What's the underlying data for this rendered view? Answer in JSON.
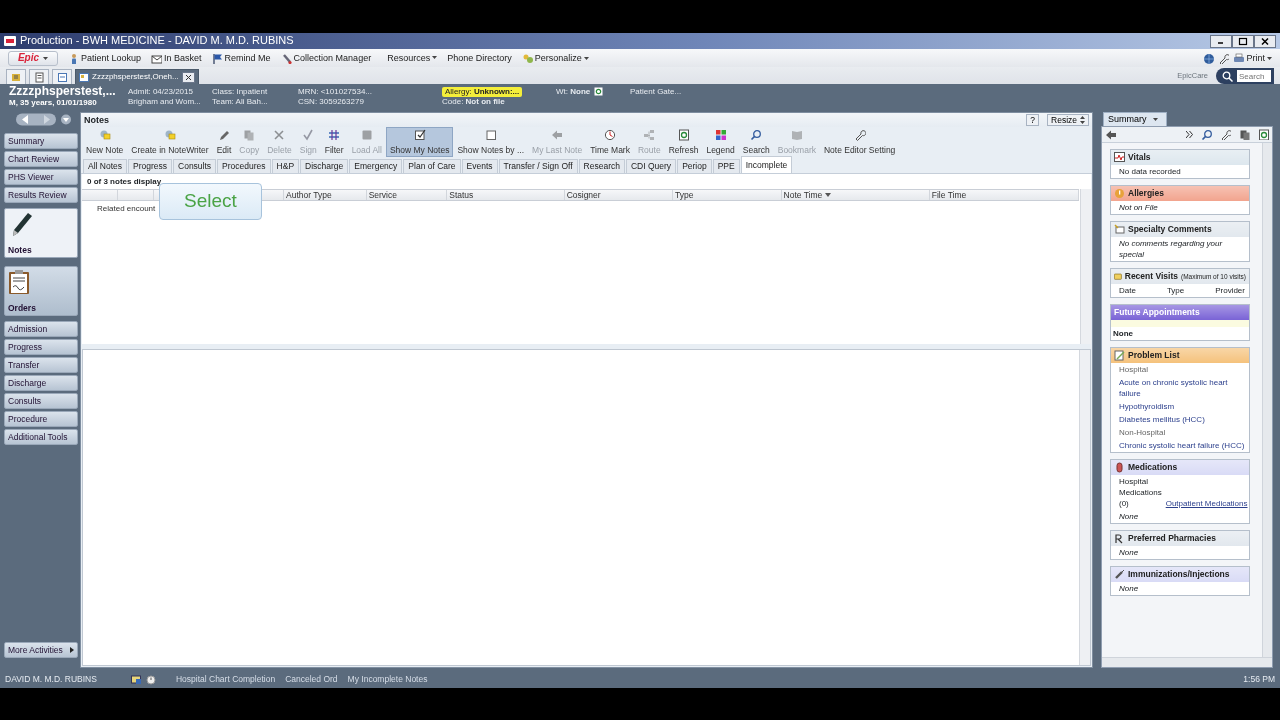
{
  "window": {
    "title": "Production - BWH MEDICINE - DAVID M. M.D. RUBINS"
  },
  "menu": {
    "brand": "Epic",
    "items": [
      {
        "label": "Patient Lookup",
        "dropdown": false
      },
      {
        "label": "In Basket",
        "dropdown": false
      },
      {
        "label": "Remind Me",
        "dropdown": false
      },
      {
        "label": "Collection Manager",
        "dropdown": false
      },
      {
        "label": "Resources",
        "dropdown": true
      },
      {
        "label": "Phone Directory",
        "dropdown": false
      },
      {
        "label": "Personalize",
        "dropdown": true
      }
    ],
    "print": "Print",
    "product": "EpicCare",
    "search_placeholder": "Search"
  },
  "workspace_tabs": [
    {
      "label": "Zzzzphsperstest,Oneh...",
      "selected": true
    }
  ],
  "patient": {
    "name": "Zzzzphsperstest,...",
    "demographics": "M, 35 years, 01/01/1980",
    "columns": [
      [
        {
          "text": "Admit: 04/23/2015",
          "alert": false
        },
        {
          "text": "Brigham and Wom...",
          "alert": false
        }
      ],
      [
        {
          "text": "Class: Inpatient",
          "alert": false
        },
        {
          "text": "Team: Ali Bah...",
          "alert": false
        }
      ],
      [
        {
          "text": "MRN: <101027534...",
          "alert": false
        },
        {
          "text": "CSN: 3059263279",
          "alert": false
        }
      ],
      [
        {
          "text": "Allergy: **Unknown:...**",
          "alert": true
        },
        {
          "text": "Code: **Not on file**",
          "alert": false
        }
      ],
      [
        {
          "text": "Wt: **None**",
          "alert": false
        }
      ],
      [
        {
          "text": "Patient Gate...",
          "alert": false
        }
      ]
    ]
  },
  "sidebar": {
    "items": [
      {
        "label": "Summary",
        "kind": "small",
        "selected": false
      },
      {
        "label": "Chart Review",
        "kind": "small",
        "selected": false
      },
      {
        "label": "PHS Viewer",
        "kind": "small",
        "selected": false
      },
      {
        "label": "Results Review",
        "kind": "small",
        "selected": false
      },
      {
        "label": "Notes",
        "kind": "big",
        "selected": true
      },
      {
        "label": "Orders",
        "kind": "big",
        "selected": false
      },
      {
        "label": "Admission",
        "kind": "small",
        "selected": false
      },
      {
        "label": "Progress",
        "kind": "small",
        "selected": false
      },
      {
        "label": "Transfer",
        "kind": "small",
        "selected": false
      },
      {
        "label": "Discharge",
        "kind": "small",
        "selected": false
      },
      {
        "label": "Consults",
        "kind": "small",
        "selected": false
      },
      {
        "label": "Procedure",
        "kind": "small",
        "selected": false
      },
      {
        "label": "Additional Tools",
        "kind": "small",
        "selected": false
      }
    ],
    "more": "More Activities"
  },
  "notes": {
    "title": "Notes",
    "help": "?",
    "resize": "Resize",
    "toolbar": [
      {
        "label": "New Note",
        "disabled": false,
        "selected": false
      },
      {
        "label": "Create in NoteWriter",
        "disabled": false,
        "selected": false
      },
      {
        "label": "Edit",
        "disabled": false,
        "selected": false
      },
      {
        "label": "Copy",
        "disabled": true,
        "selected": false
      },
      {
        "label": "Delete",
        "disabled": true,
        "selected": false
      },
      {
        "label": "Sign",
        "disabled": true,
        "selected": false
      },
      {
        "label": "Filter",
        "disabled": false,
        "selected": false
      },
      {
        "label": "Load All",
        "disabled": true,
        "selected": false
      },
      {
        "label": "Show My Notes",
        "disabled": false,
        "selected": true
      },
      {
        "label": "Show Notes by ...",
        "disabled": false,
        "selected": false
      },
      {
        "label": "My Last Note",
        "disabled": true,
        "selected": false
      },
      {
        "label": "Time Mark",
        "disabled": false,
        "selected": false
      },
      {
        "label": "Route",
        "disabled": true,
        "selected": false
      },
      {
        "label": "Refresh",
        "disabled": false,
        "selected": false
      },
      {
        "label": "Legend",
        "disabled": false,
        "selected": false
      },
      {
        "label": "Search",
        "disabled": false,
        "selected": false
      },
      {
        "label": "Bookmark",
        "disabled": true,
        "selected": false
      },
      {
        "label": "Note Editor Setting",
        "disabled": false,
        "selected": false
      }
    ],
    "tabs": [
      {
        "label": "All Notes",
        "selected": false
      },
      {
        "label": "Progress",
        "selected": false
      },
      {
        "label": "Consults",
        "selected": false
      },
      {
        "label": "Procedures",
        "selected": false
      },
      {
        "label": "H&P",
        "selected": false
      },
      {
        "label": "Discharge",
        "selected": false
      },
      {
        "label": "Emergency",
        "selected": false
      },
      {
        "label": "Plan of Care",
        "selected": false
      },
      {
        "label": "Events",
        "selected": false
      },
      {
        "label": "Transfer / Sign Off",
        "selected": false
      },
      {
        "label": "Research",
        "selected": false
      },
      {
        "label": "CDI Query",
        "selected": false
      },
      {
        "label": "Periop",
        "selected": false
      },
      {
        "label": "PPE",
        "selected": false
      },
      {
        "label": "Incomplete",
        "selected": true
      }
    ],
    "count": "0 of 3 notes display",
    "columns": [
      {
        "label": "Author Type",
        "sorted": false
      },
      {
        "label": "Service",
        "sorted": false
      },
      {
        "label": "Status",
        "sorted": false
      },
      {
        "label": "Cosigner",
        "sorted": false
      },
      {
        "label": "Type",
        "sorted": false
      },
      {
        "label": "Note Time",
        "sorted": true
      },
      {
        "label": "File Time",
        "sorted": false
      }
    ],
    "group_row": "Related encount",
    "tooltip": "Select"
  },
  "summary": {
    "tab": "Summary",
    "sections": [
      {
        "title": "Vitals",
        "color": "#dde7ee",
        "rows": [
          {
            "kind": "text",
            "text": "No data recorded"
          }
        ]
      },
      {
        "title": "Allergies",
        "color": "#f2a48e",
        "rows": [
          {
            "kind": "italic",
            "text": "Not on File"
          }
        ]
      },
      {
        "title": "Specialty Comments",
        "color": "#e2e8ee",
        "rows": [
          {
            "kind": "italic",
            "text": "No comments regarding your special"
          }
        ]
      },
      {
        "title": "Recent Visits",
        "note": "(Maximum of 10 visits)",
        "color": "#e2e8ee",
        "rows": [
          {
            "kind": "columns",
            "cells": [
              "Date",
              "Type",
              "Provider"
            ]
          }
        ]
      },
      {
        "title": "Future Appointments",
        "color": "#7a63d6",
        "rows": [
          {
            "kind": "bold",
            "text": "None"
          }
        ]
      },
      {
        "title": "Problem List",
        "color": "#f5c27c",
        "rows": [
          {
            "kind": "group",
            "text": "Hospital"
          },
          {
            "kind": "link",
            "text": "Acute on chronic systolic heart failure"
          },
          {
            "kind": "link",
            "text": "Hypothyroidism"
          },
          {
            "kind": "link",
            "text": "Diabetes mellitus (HCC)"
          },
          {
            "kind": "group",
            "text": "Non-Hospital"
          },
          {
            "kind": "link",
            "text": "Chronic systolic heart failure (HCC)"
          }
        ]
      },
      {
        "title": "Medications",
        "color": "#d9dbf6",
        "rows": [
          {
            "kind": "pair",
            "text": "Hospital Medications (0)",
            "link": "Outpatient Medications"
          },
          {
            "kind": "italic",
            "text": "None"
          }
        ]
      },
      {
        "title": "Preferred Pharmacies",
        "color": "#e2e8ee",
        "rows": [
          {
            "kind": "italic",
            "text": "None"
          }
        ]
      },
      {
        "title": "Immunizations/Injections",
        "color": "#d9dbf6",
        "rows": [
          {
            "kind": "italic",
            "text": "None"
          }
        ]
      }
    ]
  },
  "status_bar": {
    "user": "DAVID M. M.D. RUBINS",
    "items": [
      "Hospital Chart Completion",
      "Canceled Ord",
      "My Incomplete Notes"
    ],
    "time": "1:56 PM"
  }
}
